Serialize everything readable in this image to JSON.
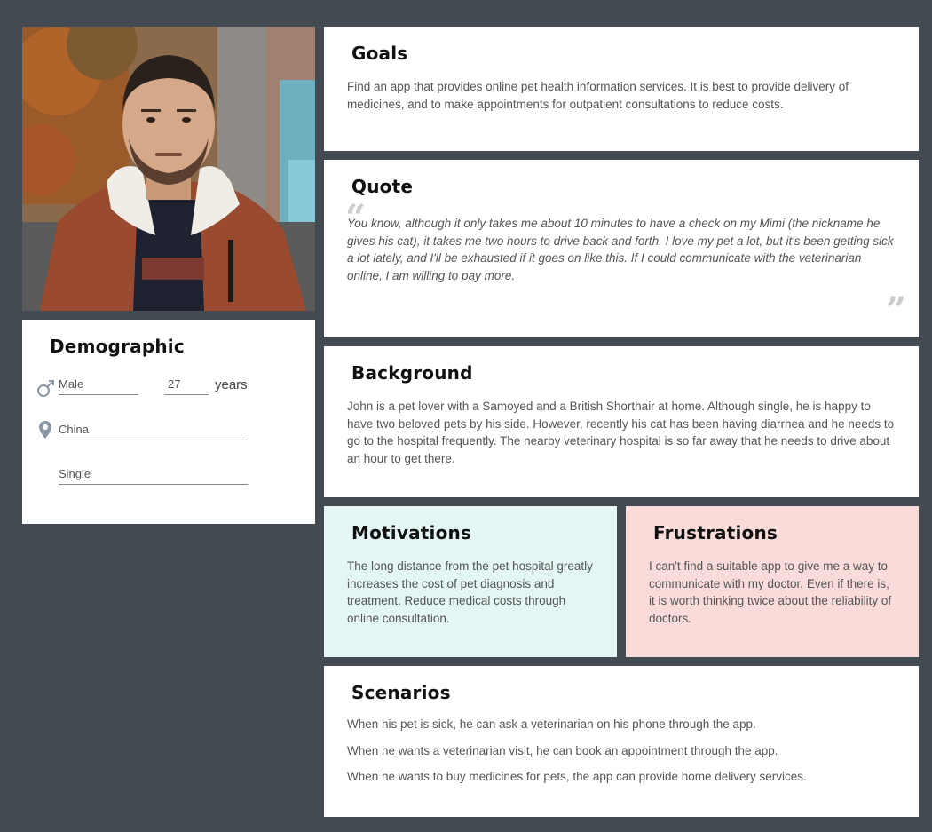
{
  "persona": {
    "photo_icon": "portrait-photo"
  },
  "demographic": {
    "title": "Demographic",
    "gender": "Male",
    "age": "27",
    "age_unit": "years",
    "location": "China",
    "status": "Single"
  },
  "goals": {
    "title": "Goals",
    "text": "Find an app that provides online pet health information services. It is best to provide delivery of medicines, and to make appointments for outpatient consultations to reduce costs."
  },
  "quote": {
    "title": "Quote",
    "text": "You know, although it only takes me about 10 minutes to have a check on my Mimi (the nickname he gives his cat), it takes me two hours to drive back and forth. I love my pet a lot, but it's been getting sick a lot lately, and I'll be exhausted if it goes on like this. If  I could communicate with the veterinarian online, I am willing to pay more."
  },
  "background": {
    "title": "Background",
    "text": "John is a pet lover with a Samoyed and a British Shorthair at home. Although single, he is happy to have two beloved pets by his side. However, recently his cat has been having diarrhea and he needs to go to the hospital frequently. The nearby veterinary hospital is so far away that he needs to drive about an hour to get there."
  },
  "motivations": {
    "title": "Motivations",
    "text": "The long distance from the pet hospital greatly increases the cost of pet diagnosis and treatment. Reduce medical costs through online consultation."
  },
  "frustrations": {
    "title": "Frustrations",
    "text": "I can't find a suitable app to give me a way to communicate with my doctor. Even if there is, it is worth thinking twice about the reliability of doctors."
  },
  "scenarios": {
    "title": "Scenarios",
    "items": [
      "When his pet is sick, he can ask a veterinarian on his phone through the app.",
      "When he wants a veterinarian visit, he can book an appointment through the app.",
      "When he wants to buy medicines for pets, the app can provide home delivery services."
    ]
  },
  "colors": {
    "page_bg": "#444a52",
    "motivations_bg": "#e4f6f3",
    "frustrations_bg": "#f9dcd9"
  }
}
